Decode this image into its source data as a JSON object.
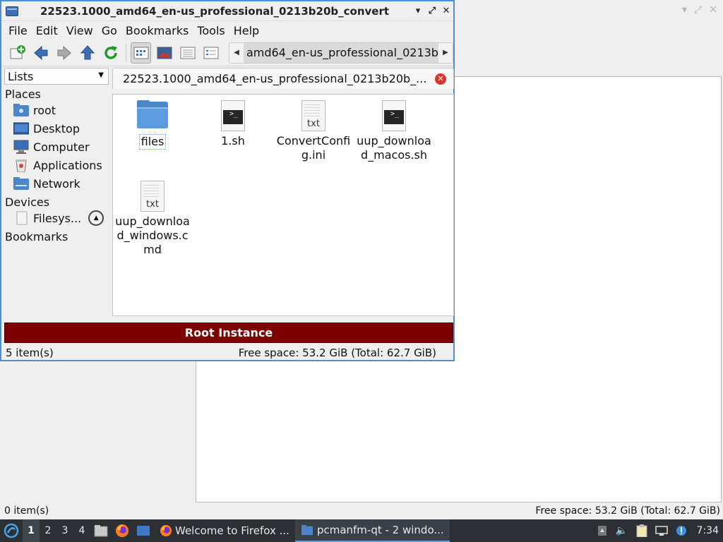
{
  "window": {
    "title": "22523.1000_amd64_en-us_professional_0213b20b_convert",
    "controls": {
      "minimize": "▾",
      "maximize": "⤢",
      "close": "✕"
    }
  },
  "menubar": [
    "File",
    "Edit",
    "View",
    "Go",
    "Bookmarks",
    "Tools",
    "Help"
  ],
  "toolbar": {
    "icons": [
      "new-tab-icon",
      "back-icon",
      "forward-icon",
      "up-icon",
      "reload-icon",
      "icon-view-icon",
      "thumbnail-view-icon",
      "compact-view-icon",
      "detailed-view-icon"
    ],
    "path_crumb": "amd64_en-us_professional_0213b"
  },
  "sidepane": {
    "mode": "Lists",
    "places_label": "Places",
    "places": [
      "root",
      "Desktop",
      "Computer",
      "Applications",
      "Network"
    ],
    "devices_label": "Devices",
    "devices": [
      "Filesys..."
    ],
    "bookmarks_label": "Bookmarks"
  },
  "tab": {
    "label": "22523.1000_amd64_en-us_professional_0213b20b_..."
  },
  "files": [
    {
      "name": "files",
      "type": "folder"
    },
    {
      "name": "1.sh",
      "type": "script"
    },
    {
      "name": "ConvertConfig.ini",
      "type": "text",
      "icon_text": "txt"
    },
    {
      "name": "uup_download_macos.sh",
      "type": "script"
    },
    {
      "name": "uup_download_windows.cmd",
      "type": "text",
      "icon_text": "txt"
    }
  ],
  "banner": "Root Instance",
  "status": {
    "items": "5 item(s)",
    "free_space": "Free space: 53.2 GiB (Total: 62.7 GiB)"
  },
  "background_window": {
    "status_items": "0 item(s)",
    "status_free": "Free space: 53.2 GiB (Total: 62.7 GiB)"
  },
  "taskbar": {
    "desktops": [
      "1",
      "2",
      "3",
      "4"
    ],
    "tasks": [
      "Welcome to Firefox ...",
      "pcmanfm-qt - 2 windo..."
    ],
    "clock": "7:34"
  },
  "colors": {
    "banner": "#7c0000",
    "accent": "#4a90d9",
    "taskbar": "#2c3035"
  }
}
